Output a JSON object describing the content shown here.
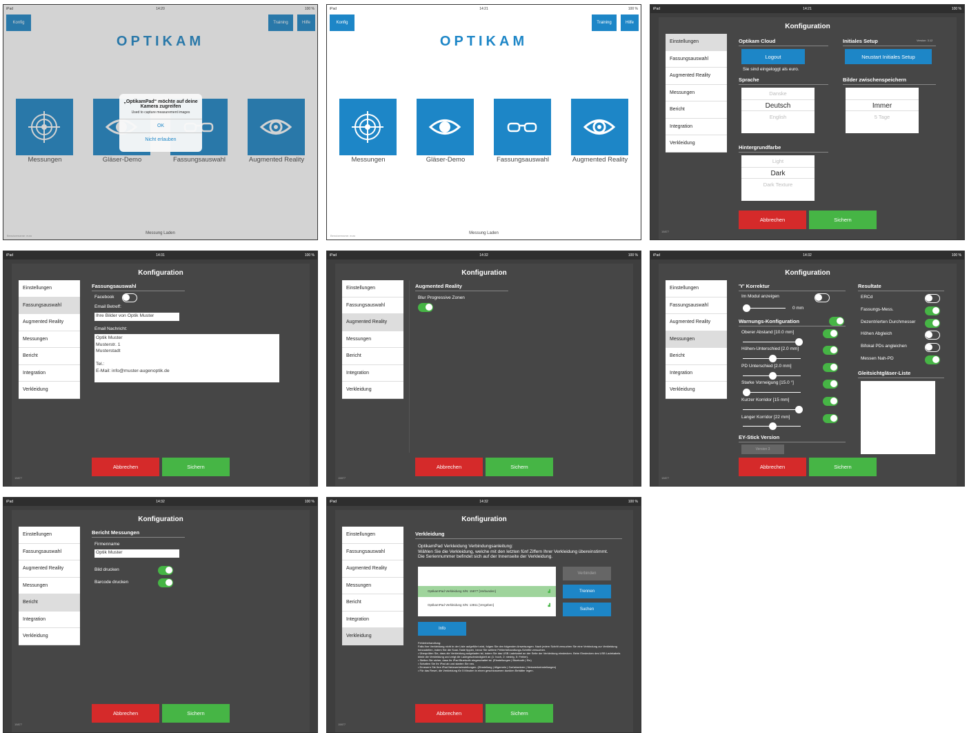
{
  "status_times": {
    "p1": "14:20",
    "p2": "14:21",
    "p3": "14:21",
    "p4": "14:31",
    "p5": "14:32",
    "p6": "14:32",
    "p7": "14:32",
    "p8": "14:32"
  },
  "status_left": "iPad",
  "status_right": "100 %",
  "home": {
    "konfig": "Konfig",
    "training": "Training",
    "hilfe": "Hilfe",
    "logo": "OPTIKAM",
    "tiles": [
      "Messungen",
      "Gläser-Demo",
      "Fassungsauswahl",
      "Augmented Reality"
    ],
    "footer": "Messung Laden",
    "user": "Benutzername: euro"
  },
  "alert": {
    "title": "„OptikamPad“ möchte auf deine Kamera zugreifen",
    "message": "Used to capture measurement images",
    "ok": "OK",
    "deny": "Nicht erlauben"
  },
  "config": {
    "title": "Konfiguration",
    "menu": [
      "Einstellungen",
      "Fassungsauswahl",
      "Augmented Reality",
      "Messungen",
      "Bericht",
      "Integration",
      "Verkleidung"
    ],
    "cancel": "Abbrechen",
    "save": "Sichern",
    "build": "15877"
  },
  "einstellungen": {
    "cloud": "Optikam Cloud",
    "logout": "Logout",
    "logged_in": "Sie sind eingeloggt als euro.",
    "setup": "Initiales Setup",
    "version": "Version: 3.12",
    "restart": "Neustart Initiales Setup",
    "sprache": "Sprache",
    "lang": [
      "Danske",
      "Deutsch",
      "English"
    ],
    "cache": "Bilder zwischenspeichern",
    "cache_opts": [
      "Immer",
      "5 Tage"
    ],
    "bg": "Hintergrundfarbe",
    "bg_opts": [
      "Light",
      "Dark",
      "Dark Texture"
    ]
  },
  "fassung": {
    "title": "Fassungsauswahl",
    "facebook": "Facebook",
    "subject_label": "Email Betreff:",
    "subject": "Ihre Bilder von Optik Muster",
    "msg_label": "Email Nachricht:",
    "msg": "Optik Muster\nMusterstr. 1\nMusterstadt\n\nTel.:\nE-Mail: info@muster-augenoptik.de"
  },
  "ar": {
    "title": "Augmented Reality",
    "blur": "Blur Progressive Zonen"
  },
  "messungen": {
    "y": "'Y' Korrektur",
    "im_modul": "Im Modul anzeigen",
    "mm": "0 mm",
    "warn": "Warnungs-Konfiguration",
    "warn_items": [
      "Oberer Abstand  [10.0 mm]",
      "Höhen-Unterschied  [2.0 mm]",
      "PD Unterschied  [2.0 mm]",
      "Starke Vorneigung  [15.0 °]",
      "Kurzer Korridor  [15 mm]",
      "Langer Korridor  [22 mm]"
    ],
    "ey": "EY-Stick Version",
    "ey_ver": "Version 3",
    "result": "Resultate",
    "result_items": [
      "ERCd",
      "Fassungs-Mess.",
      "Dezentrierten Durchmesser",
      "Höhen Abgleich",
      "Bifokal PDs angleichen",
      "Messen Nah-PD"
    ],
    "glei": "Gleitsichtgläser-Liste"
  },
  "bericht": {
    "title": "Bericht Messungen",
    "firm_label": "Firmenname",
    "firm": "Optik Muster",
    "bild": "Bild drucken",
    "barcode": "Barcode drucken"
  },
  "verkleidung": {
    "title": "Verkleidung",
    "intro": "OptikamPad Verkleidung Verbindungsanleitung:\nWählen Sie die Verkleidung, welche mit den letzten fünf Ziffern Ihrer Verkleidung übereinstimmt. Die Seriennummer befindet sich auf der Innenseite der Verkleidung.",
    "dev1": "OptikamPad Verkleidung S/N: 15877 [Verbunden]",
    "dev2": "OptikamPad Verkleidung S/N: 13811 [Vergeben]",
    "verbinden": "Verbinden",
    "trennen": "Trennen",
    "suchen": "Suchen",
    "info": "Info",
    "help": "Fehlerbehandlung:\nFalls Ihre Verkleidung nicht in der Liste aufgeführt wird, folgen Sie den folgenden Anweisungen. Nach jedem Schritt versuchen Sie eine Verbindung zur Verkleidung herzustellen, indem Sie die Scan-Taste tippen, bevor Sie weitere Fehlerbehandlungs-Schritte versuchen.\n• Überprüfen Sie, dass die Verkleidung aufgeladen ist, indem Sie das USB Ladekabel an der Seite der Verkleidung einstecken. Beim Einstecken des USB Ladekabels blinkt die Verkleidung und zeigt die Ladegeschwindigkeit an (1: hoch, 2: niedrig, 5: Fehler).\n• Stellen Sie sicher, dass Ihr iPad Bluetooth eingeschaltet ist. (Einstellungen | Bluetooth | Ein)\n• Schalten Sie Ihr iPad ab und starten Sie neu.\n• Erneuern Sie Ihre iPad Netzwerkeinstellungen. (Einstellung | Allgemein | Zurücksetzen | Netzwerkeinstellungen)\n• Für das Reset, die Verkleidung für 5 Minuten in einen geschlossenen dunklen Behälter legen."
  }
}
